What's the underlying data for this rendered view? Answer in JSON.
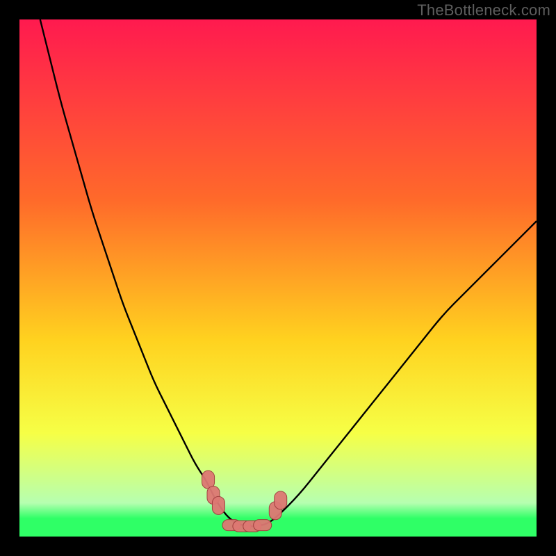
{
  "watermark": "TheBottleneck.com",
  "colors": {
    "frame_bg": "#000000",
    "gradient_top": "#ff1a4f",
    "gradient_mid1": "#ff6a2a",
    "gradient_mid2": "#ffd21f",
    "gradient_mid3": "#f6ff46",
    "gradient_green_pale": "#b6ffb0",
    "gradient_green": "#2fff66",
    "curve_stroke": "#000000",
    "markers_fill": "#dd7873",
    "markers_stroke": "#9e3b3b"
  },
  "chart_data": {
    "type": "line",
    "title": "",
    "xlabel": "",
    "ylabel": "",
    "xlim": [
      0,
      100
    ],
    "ylim": [
      0,
      100
    ],
    "series": [
      {
        "name": "bottleneck-curve",
        "x": [
          4,
          6,
          8,
          10,
          12,
          14,
          16,
          18,
          20,
          22,
          24,
          26,
          28,
          30,
          32,
          34,
          36,
          37,
          38,
          40,
          42,
          44,
          46,
          48,
          50,
          54,
          58,
          62,
          66,
          70,
          74,
          78,
          82,
          86,
          90,
          94,
          98,
          100
        ],
        "y": [
          100,
          92,
          84,
          77,
          70,
          63,
          57,
          51,
          45,
          40,
          35,
          30,
          26,
          22,
          18,
          14,
          11,
          9,
          7,
          4,
          2.5,
          2,
          2,
          2.5,
          4,
          8,
          13,
          18,
          23,
          28,
          33,
          38,
          43,
          47,
          51,
          55,
          59,
          61
        ]
      }
    ],
    "markers": [
      {
        "name": "left-cluster-1",
        "x": 36.5,
        "y": 11
      },
      {
        "name": "left-cluster-2",
        "x": 37.5,
        "y": 8
      },
      {
        "name": "left-cluster-3",
        "x": 38.5,
        "y": 6
      },
      {
        "name": "bottom-bar-1",
        "x": 41,
        "y": 2.2
      },
      {
        "name": "bottom-bar-2",
        "x": 43,
        "y": 2.0
      },
      {
        "name": "bottom-bar-3",
        "x": 45,
        "y": 2.0
      },
      {
        "name": "bottom-bar-4",
        "x": 47,
        "y": 2.2
      },
      {
        "name": "right-cluster-1",
        "x": 49.5,
        "y": 5
      },
      {
        "name": "right-cluster-2",
        "x": 50.5,
        "y": 7
      }
    ],
    "gradient_stops": [
      {
        "offset": 0.0,
        "color_key": "gradient_top"
      },
      {
        "offset": 0.35,
        "color_key": "gradient_mid1"
      },
      {
        "offset": 0.62,
        "color_key": "gradient_mid2"
      },
      {
        "offset": 0.8,
        "color_key": "gradient_mid3"
      },
      {
        "offset": 0.935,
        "color_key": "gradient_green_pale"
      },
      {
        "offset": 0.965,
        "color_key": "gradient_green"
      },
      {
        "offset": 1.0,
        "color_key": "gradient_green"
      }
    ]
  }
}
